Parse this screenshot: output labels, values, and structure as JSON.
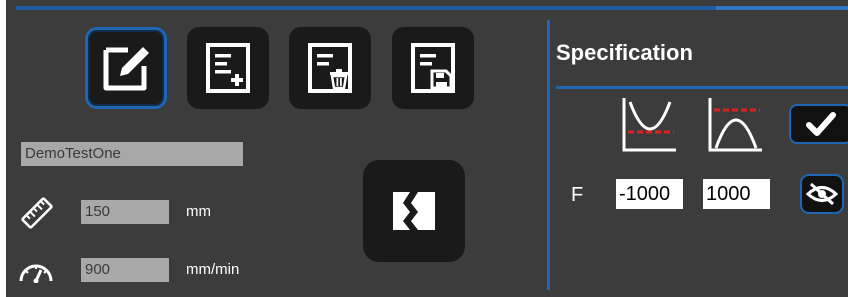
{
  "toolbar": {
    "edit_icon": "edit-icon",
    "new_icon": "new-document-icon",
    "delete_icon": "delete-document-icon",
    "save_icon": "save-document-icon"
  },
  "settings": {
    "test_name": "DemoTestOne",
    "length": {
      "value": "150",
      "unit": "mm",
      "icon": "ruler-icon"
    },
    "speed": {
      "value": "900",
      "unit": "mm/min",
      "icon": "speedometer-icon"
    },
    "action_icon": "sample-break-icon"
  },
  "specification": {
    "title": "Specification",
    "min_curve_icon": "min-limit-curve-icon",
    "max_curve_icon": "max-limit-curve-icon",
    "confirm_icon": "check-icon",
    "row_label": "F",
    "lower_limit": "-1000",
    "upper_limit": "1000",
    "visibility_icon": "eye-off-icon"
  },
  "colors": {
    "background": "#3c3c3c",
    "button": "#1a1a1a",
    "accent": "#1f67b4",
    "input": "#a8a8a8",
    "limit_line": "#e02020"
  }
}
